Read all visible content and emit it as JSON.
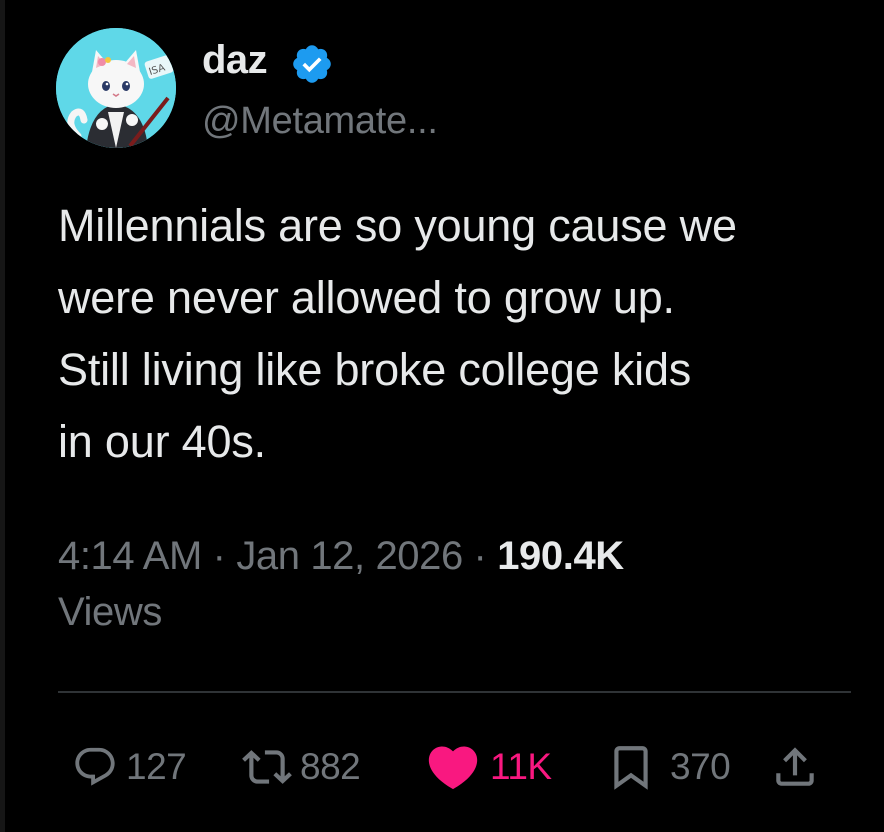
{
  "colors": {
    "background": "#000000",
    "primary_text": "#e7e9ea",
    "secondary_text": "#71767b",
    "verified_blue": "#1d9bf0",
    "like_pink": "#f91880",
    "divider": "#2f3336"
  },
  "author": {
    "display_name": "daz",
    "handle": "@Metamate...",
    "verified": true,
    "avatar_icon": "white-cat-avatar"
  },
  "tweet": {
    "text": "Millennials are so young cause we\nwere never allowed to grow up.\nStill living like broke college kids\nin our 40s."
  },
  "meta": {
    "time": "4:14 AM",
    "separator": " · ",
    "date": "Jan 12, 2026",
    "views_count": "190.4K",
    "views_label": "Views"
  },
  "actions": {
    "reply": {
      "icon": "reply-icon",
      "count": "127"
    },
    "retweet": {
      "icon": "retweet-icon",
      "count": "882"
    },
    "like": {
      "icon": "heart-icon",
      "count": "11K",
      "liked": true
    },
    "bookmark": {
      "icon": "bookmark-icon",
      "count": "370"
    },
    "share": {
      "icon": "share-icon"
    }
  }
}
